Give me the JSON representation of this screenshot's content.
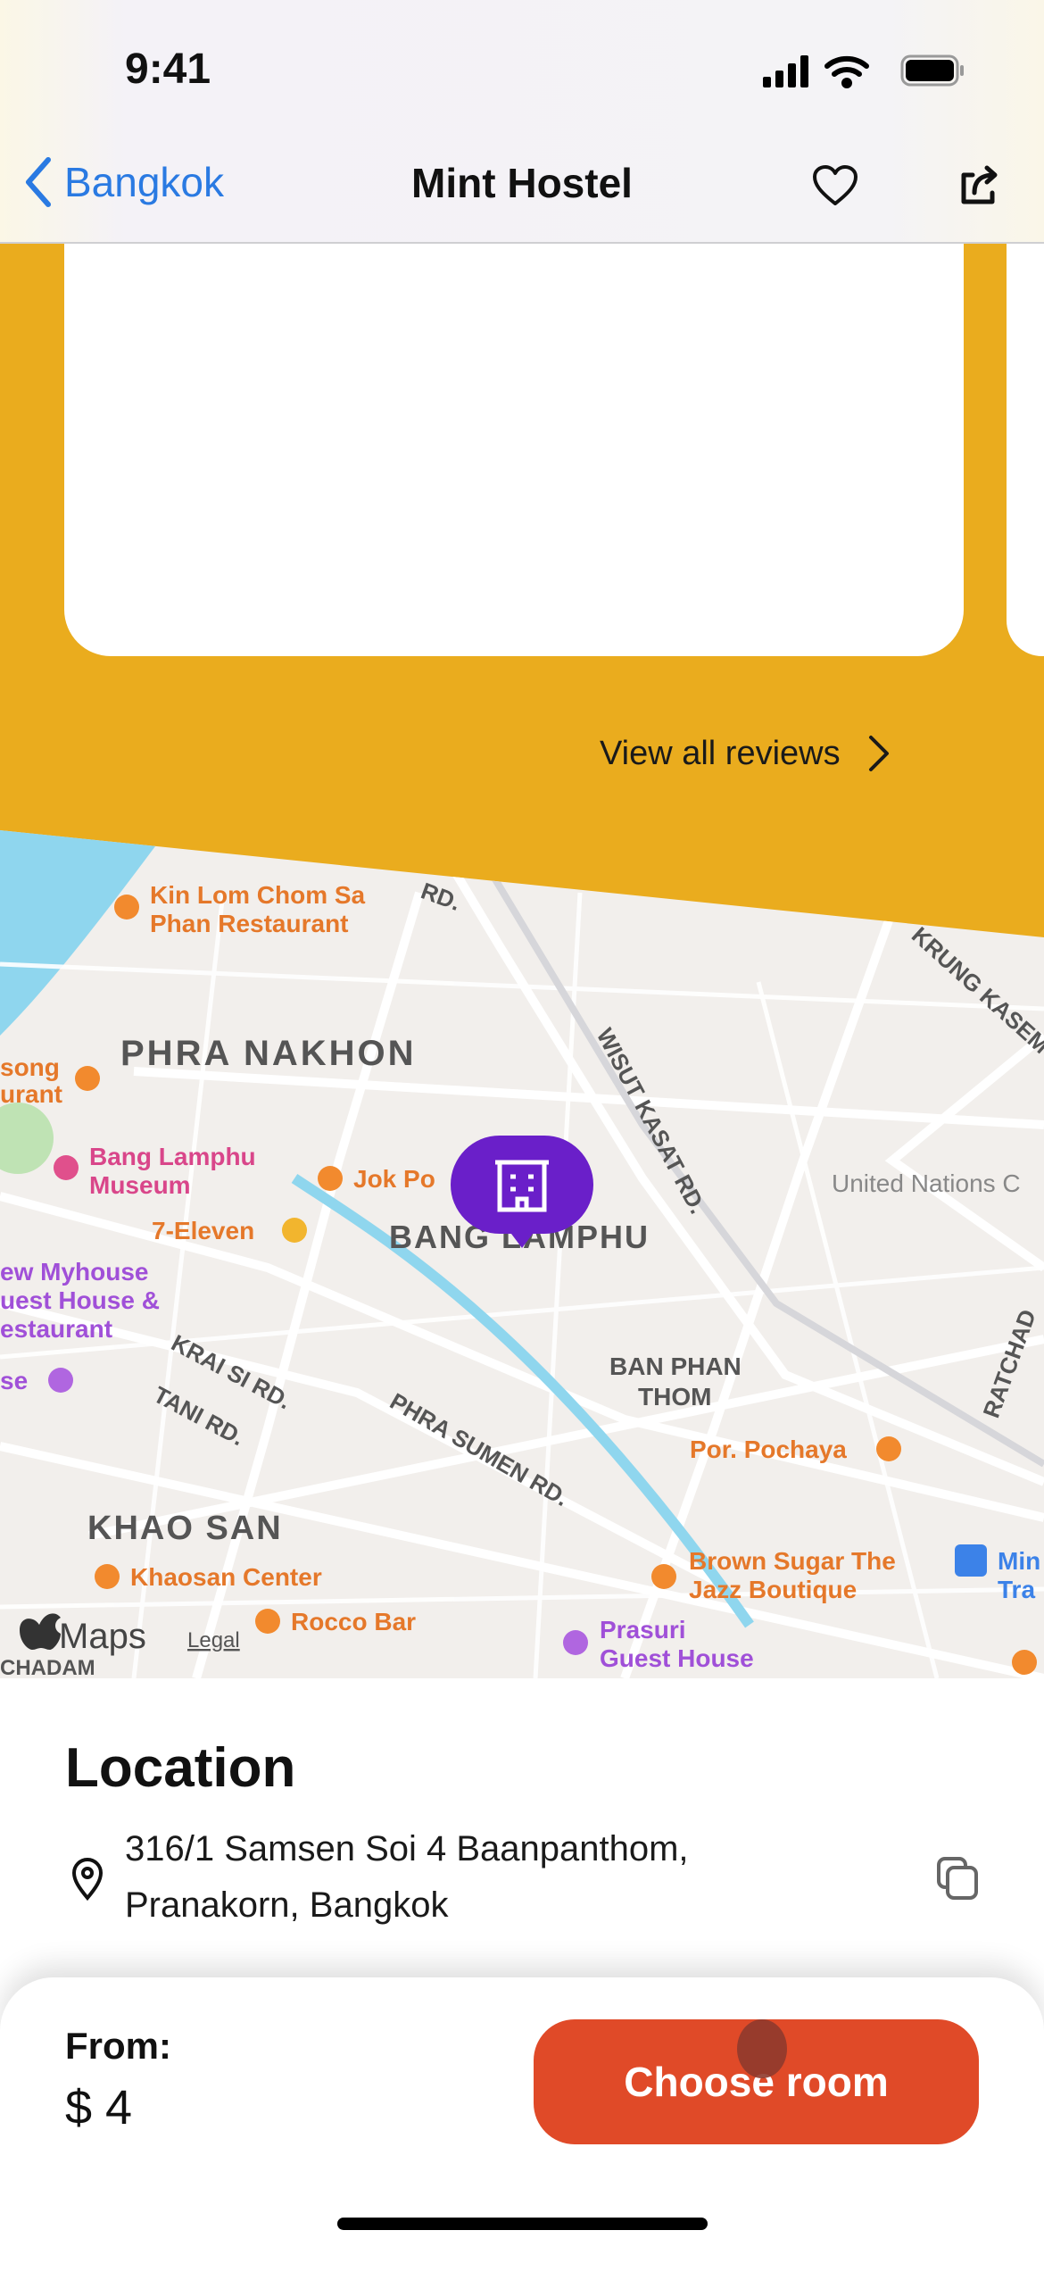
{
  "status_bar": {
    "time": "9:41"
  },
  "nav": {
    "back_label": "Bangkok",
    "title": "Mint Hostel",
    "favorite_icon": "heart-icon",
    "share_icon": "share-icon"
  },
  "reviews": {
    "view_all_label": "View all reviews"
  },
  "map": {
    "labels": {
      "kin_lom_1": "Kin Lom Chom Sa",
      "kin_lom_2": "Phan Restaurant",
      "phra_nakhon": "PHRA NAKHON",
      "song": "song",
      "urant": "urant",
      "museum_1": "Bang Lamphu",
      "museum_2": "Museum",
      "jok": "Jok Po",
      "seven": "7-Eleven",
      "bang_lamphu": "BANG LAMPHU",
      "myhouse_1": "ew Myhouse",
      "myhouse_2": "uest House &",
      "myhouse_3": "estaurant",
      "se": "se",
      "krai_si": "KRAI SI RD.",
      "tani": "TANI RD.",
      "phra_sumen": "PHRA SUMEN RD.",
      "khao_san": "KHAO SAN",
      "khaosan_center": "Khaosan Center",
      "rocco": "Rocco Bar",
      "ban_phan_1": "BAN PHAN",
      "ban_phan_2": "THOM",
      "pochaya": "Por. Pochaya",
      "brown_1": "Brown Sugar The",
      "brown_2": "Jazz Boutique",
      "prasuri_1": "Prasuri",
      "prasuri_2": "Guest House",
      "un": "United Nations C",
      "wisut": "WISUT KASAT RD.",
      "krung": "KRUNG KASEM",
      "ratchad": "RATCHAD",
      "rd": "RD.",
      "mi_1": "Min",
      "mi_2": "Tra",
      "chadam": "CHADAM",
      "maps": "Maps",
      "legal": "Legal"
    },
    "colors": {
      "land": "#F2EFEC",
      "road": "#FFFFFF",
      "water": "#8FD6EE",
      "poi_food": "#F28A2E",
      "poi_museum": "#E0508C",
      "poi_hotel": "#B066E0",
      "pin": "#6A1FC9"
    }
  },
  "location": {
    "heading": "Location",
    "address_line1": "316/1 Samsen Soi 4 Baanpanthom,",
    "address_line2": "Pranakorn, Bangkok"
  },
  "booking": {
    "from_label": "From:",
    "price": "$ 4",
    "choose_room_label": "Choose room"
  },
  "colors": {
    "accent_yellow": "#EAAC1E",
    "button": "#E04A28",
    "link": "#2A7AE2"
  }
}
